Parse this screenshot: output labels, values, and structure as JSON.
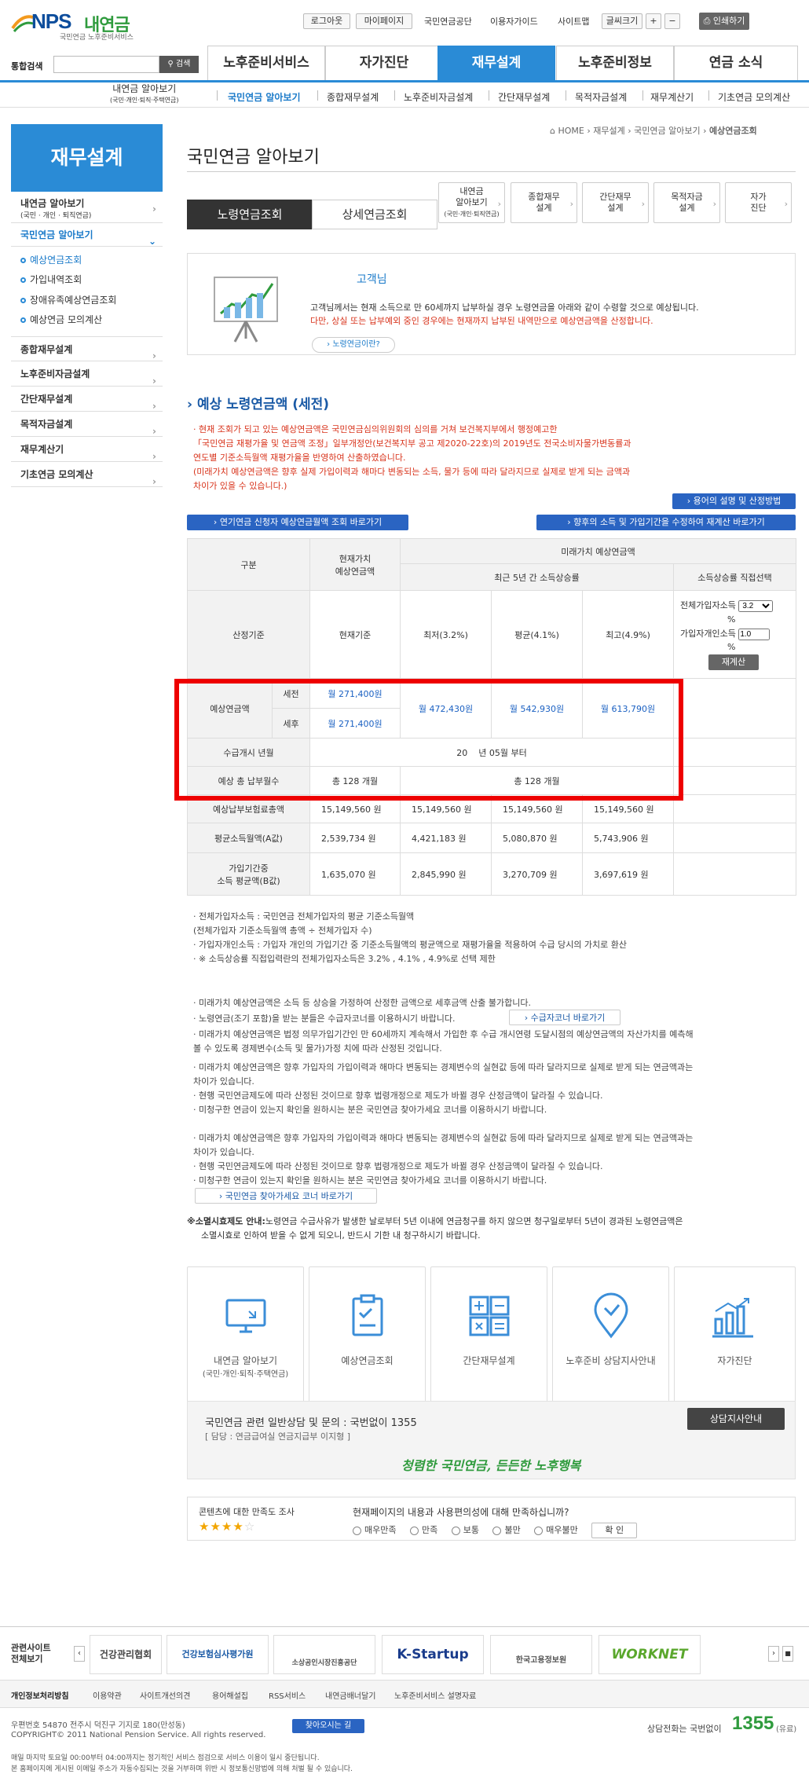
{
  "header": {
    "logo": {
      "brand": "NPS",
      "name": "내연금",
      "sub": "국민연금 노후준비서비스"
    },
    "top_links": [
      "로그아웃",
      "마이페이지",
      "국민연금공단",
      "이용자가이드",
      "사이트맵",
      "글씨크기",
      "+",
      "−"
    ],
    "print": "인쇄하기",
    "search": {
      "label": "통합검색",
      "placeholder": "",
      "button": "검색"
    },
    "gnb": [
      "노후준비서비스",
      "자가진단",
      "재무설계",
      "노후준비정보",
      "연금 소식"
    ],
    "sub_nav": [
      {
        "label": "내연금 알아보기",
        "sub": "(국민·개인·퇴직·주택연금)"
      },
      {
        "label": "국민연금 알아보기"
      },
      {
        "label": "종합재무설계"
      },
      {
        "label": "노후준비자금설계"
      },
      {
        "label": "간단재무설계"
      },
      {
        "label": "목적자금설계"
      },
      {
        "label": "재무계산기"
      },
      {
        "label": "기초연금 모의계산"
      }
    ]
  },
  "lnb": {
    "title": "재무설계",
    "items": [
      {
        "label": "내연금 알아보기",
        "sub": "(국민 · 개인 · 퇴직연금)"
      },
      {
        "label": "국민연금 알아보기"
      },
      {
        "label": "종합재무설계"
      },
      {
        "label": "노후준비자금설계"
      },
      {
        "label": "간단재무설계"
      },
      {
        "label": "목적자금설계"
      },
      {
        "label": "재무계산기"
      },
      {
        "label": "기초연금 모의계산"
      }
    ],
    "sub_items": [
      "예상연금조회",
      "가입내역조회",
      "장애유족예상연금조회",
      "예상연금 모의계산"
    ]
  },
  "breadcrumb": [
    "HOME",
    "재무설계",
    "국민연금 알아보기",
    "예상연금조회"
  ],
  "page_title": "국민연금 알아보기",
  "tabs": [
    "노령연금조회",
    "상세연금조회"
  ],
  "quick_links": [
    {
      "l1": "내연금",
      "l2": "알아보기",
      "l3": "(국민·개인·퇴직연금)"
    },
    {
      "l1": "종합재무",
      "l2": "설계",
      "l3": ""
    },
    {
      "l1": "간단재무",
      "l2": "설계",
      "l3": ""
    },
    {
      "l1": "목적자금",
      "l2": "설계",
      "l3": ""
    },
    {
      "l1": "자가",
      "l2": "진단",
      "l3": ""
    }
  ],
  "intro": {
    "name": "고객님",
    "text1": "고객님께서는 현재 소득으로 만 60세까지 납부하실 경우 노령연금을 아래와 같이 수령할 것으로 예상됩니다.",
    "text2": "다만, 상실 또는 납부예외 중인 경우에는 현재까지 납부된 내역만으로 예상연금액을 산정합니다.",
    "button": "노령연금이란?"
  },
  "section_title": "예상 노령연금액 (세전)",
  "notes": [
    "· 현재 조회가 되고 있는 예상연금액은 국민연금심의위원회의 심의를 거쳐 보건복지부에서 행정예고한",
    "  「국민연금 재평가율 및 연금액 조정」일부개정안(보건복지부 공고 제2020-22호)의 2019년도 전국소비자물가변동률과",
    "  연도별 기준소득월액 재평가율을 반영하여 산출하였습니다.",
    "  (미래가치 예상연금액은 향후 실제 가입이력과 해마다 변동되는 소득, 물가 등에 따라 달라지므로 실제로 받게 되는 금액과",
    "  차이가 있을 수 있습니다.)"
  ],
  "buttons": {
    "terms": "용어의 설명 및 산정방법",
    "early": "연기연금 신청자 예상연금월액 조회 바로가기",
    "recalc_income": "향후의 소득 및 가입기간을 수정하여 재계산 바로가기"
  },
  "table": {
    "h_gubun": "구분",
    "h_present": "현재가치\n예상연금액",
    "h_future": "미래가치 예상연금액",
    "h_recent": "최근 5년 간 소득상승률",
    "h_direct": "소득상승률 직접선택",
    "basis_label": "산정기준",
    "basis": [
      "현재기준",
      "최저(3.2%)",
      "평균(4.1%)",
      "최고(4.9%)"
    ],
    "direct": {
      "l1": "전체가입자소득",
      "sel": "3.2",
      "pct": "%",
      "l2": "가입자개인소득",
      "val": "1.0",
      "pct2": "%",
      "btn": "재계산"
    },
    "pension_label": "예상연금액",
    "pretax": "세전",
    "posttax": "세후",
    "pretax_present": "월 271,400원",
    "posttax_present": "월 271,400원",
    "future": [
      "월 472,430원",
      "월 542,930원",
      "월 613,790원"
    ],
    "start_label": "수급개시 년월",
    "start_value": "20    년 05월 부터",
    "months_label": "예상 총 납부월수",
    "months_present": "총 128 개월",
    "months_future": "총 128 개월",
    "total_label": "예상납부보험료총액",
    "total": [
      "15,149,560 원",
      "15,149,560 원",
      "15,149,560 원",
      "15,149,560 원"
    ],
    "a_label": "평균소득월액(A값)",
    "a": [
      "2,539,734 원",
      "4,421,183 원",
      "5,080,870 원",
      "5,743,906 원"
    ],
    "b_label1": "가입기간중",
    "b_label2": "소득 평균액(B값)",
    "b": [
      "1,635,070 원",
      "2,845,990 원",
      "3,270,709 원",
      "3,697,619 원"
    ]
  },
  "bullets1": [
    "· 전체가입자소득 : 국민연금 전체가입자의 평균 기준소득월액",
    "  (전체가입자 기준소득월액 총액 ÷ 전체가입자 수)",
    "· 가입자개인소득 : 가입자 개인의 가입기간 중 기준소득월액의 평균액으로 재평가율을 적용하여 수급 당시의 가치로 환산",
    "· ※ 소득상승률 직접입력란의 전체가입자소득은 3.2% , 4.1% , 4.9%로 선택 제한"
  ],
  "bullets2": [
    "· 미래가치 예상연금액은 소득 등 상승을 가정하여 산정한 금액으로 세후금액 산출 불가합니다.",
    "· 노령연금(조기 포함)을 받는 분들은 수급자코너를 이용하시기 바랍니다.",
    "· 미래가치 예상연금액은 법정 의무가입기간인 만 60세까지 계속해서 가입한 후 수급 개시연령 도달시점의 예상연금액의 자산가치를 예측해",
    "  볼 수 있도록 경제변수(소득 및 물가)가정 치에 따라 산정된 것입니다.",
    "· 미래가치 예상연금액은 향후 가입자의 가입이력과 해마다 변동되는 경제변수의 실현값 등에 따라 달라지므로 실제로 받게 되는 연금액과는",
    "  차이가 있습니다.",
    "· 현행 국민연금제도에 따라 산정된 것이므로 향후 법령개정으로 제도가 바뀔 경우 산정금액이 달라질 수 있습니다.",
    "· 미청구한   연금이   있는지   확인을   원하시는   분은   국민연금   찾아가세요   코너를   이용하시기   바랍니다.",
    "· 미래가치 예상연금액은 향후 가입자의 가입이력과 해마다 변동되는 경제변수의 실현값 등에 따라 달라지므로 실제로 받게 되는 연금액과는",
    "  차이가 있습니다.",
    "· 현행 국민연금제도에 따라 산정된 것이므로 향후 법령개정으로 제도가 바뀔 경우 산정금액이 달라질 수 있습니다.",
    "· 미청구한   연금이   있는지   확인을   원하시는   분은   국민연금   찾아가세요   코너를   이용하시기   바랍니다."
  ],
  "btn_recipient": "수급자코너 바로가기",
  "btn_find": "국민연금 찾아가세요 코너 바로가기",
  "extinct": {
    "head": "※소멸시효제도 안내:",
    "l1": "노령연금 수급사유가 발생한 날로부터 5년 이내에 연금청구를 하지 않으면 청구일로부터 5년이 경과된 노령연금액은",
    "l2": "소멸시효로 인하여 받을 수 없게 되오니, 반드시 기한 내 청구하시기 바랍니다."
  },
  "icon_cards": [
    {
      "l1": "내연금 알아보기",
      "l2": "(국민·개인·퇴직·주택연금)",
      "icon": "monitor-icon"
    },
    {
      "l1": "예상연금조회",
      "l2": "",
      "icon": "clipboard-icon"
    },
    {
      "l1": "간단재무설계",
      "l2": "",
      "icon": "calculator-icon"
    },
    {
      "l1": "노후준비 상담지사안내",
      "l2": "",
      "icon": "location-pin-icon"
    },
    {
      "l1": "자가진단",
      "l2": "",
      "icon": "bar-chart-icon"
    }
  ],
  "counsel": {
    "line1": "국민연금 관련 일반상담 및 문의 : 국번없이 1355",
    "line2": "[ 담당 : 연금급여실 연금지급부 이지형 ]",
    "button": "상담지사안내",
    "slogan": "청렴한 국민연금, 든든한 노후행복"
  },
  "survey": {
    "title": "콘텐츠에 대한 만족도 조사",
    "question": "현재페이지의 내용과 사용편의성에 대해 만족하십니까?",
    "options": [
      "매우만족",
      "만족",
      "보통",
      "불만",
      "매우불만"
    ],
    "submit": "확 인"
  },
  "related": {
    "label1": "관련사이트",
    "label2": "전체보기",
    "banners": [
      "건강관리협회",
      "건강보험심사평가원",
      "소상공인시장진흥공단",
      "K-Startup",
      "한국고용정보원",
      "WORKNET"
    ]
  },
  "footer": {
    "menu": [
      "개인정보처리방침",
      "이용약관",
      "사이트개선의견",
      "용어해설집",
      "RSS서비스",
      "내연금배너달기",
      "노후준비서비스 설명자료"
    ],
    "addr": "우편번호 54870   전주시 덕진구 기지로 180(만성동)",
    "copy": "COPYRIGHT© 2011 National Pension Service. All rights reserved.",
    "way": "찾아오시는 길",
    "notice1": "매일 마지막 토요일 00:00부터 04:00까지는 정기적인 서비스 점검으로 서비스 이용이 일시 중단됩니다.",
    "notice2": "본 홈페이지에 게시된 이메일 주소가 자동수집되는 것을 거부하며 위반 시 정보통신망법에 의해 처벌 될 수 있습니다.",
    "callcenter": "상담전화는 국번없이",
    "number": "1355",
    "paid": "(유료)"
  }
}
